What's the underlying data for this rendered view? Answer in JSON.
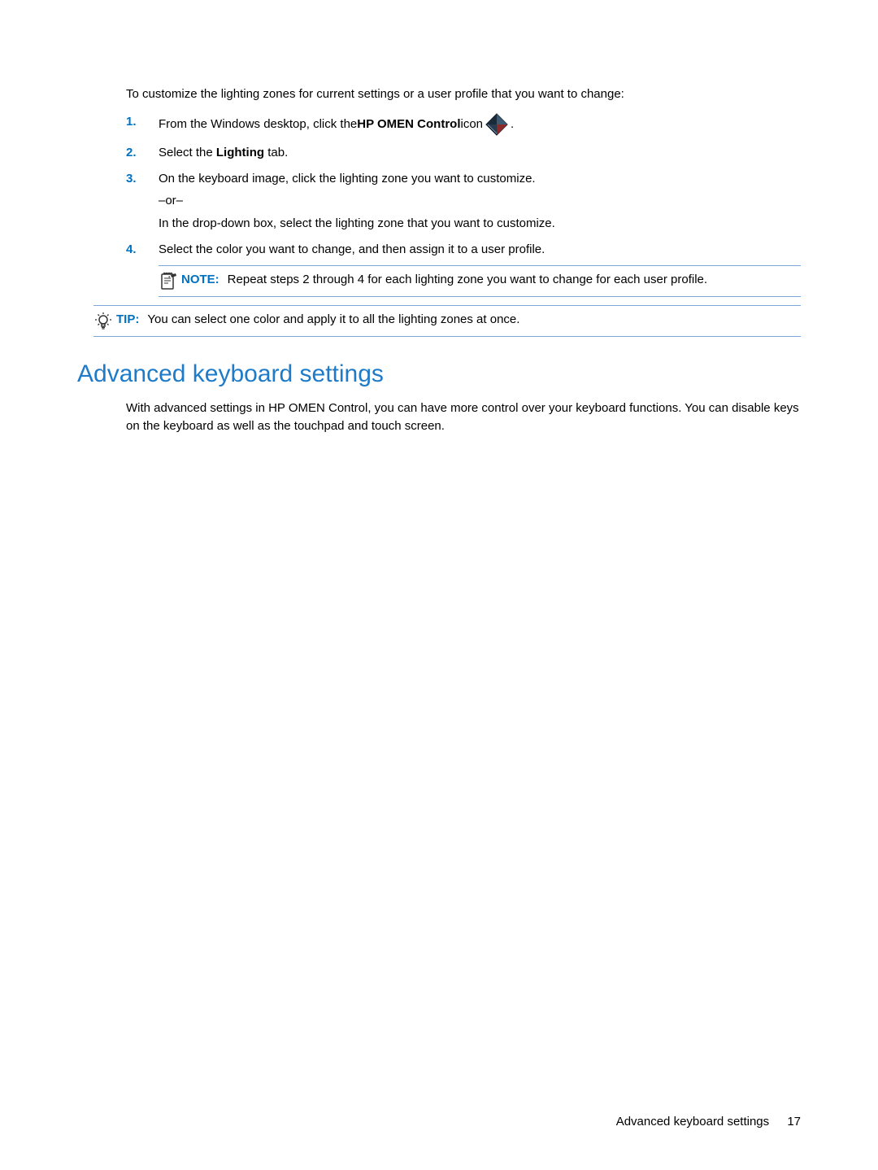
{
  "intro": "To customize the lighting zones for current settings or a user profile that you want to change:",
  "steps": {
    "s1": {
      "num": "1.",
      "pre": "From the Windows desktop, click the ",
      "bold": "HP OMEN Control",
      "mid": " icon ",
      "post": "."
    },
    "s2": {
      "num": "2.",
      "pre": "Select the ",
      "bold": "Lighting",
      "post": " tab."
    },
    "s3": {
      "num": "3.",
      "line1": "On the keyboard image, click the lighting zone you want to customize.",
      "or": "–or–",
      "line2": "In the drop-down box, select the lighting zone that you want to customize."
    },
    "s4": {
      "num": "4.",
      "text": "Select the color you want to change, and then assign it to a user profile."
    }
  },
  "note": {
    "label": "NOTE:",
    "text": "Repeat steps 2 through 4 for each lighting zone you want to change for each user profile."
  },
  "tip": {
    "label": "TIP:",
    "text": "You can select one color and apply it to all the lighting zones at once."
  },
  "heading": "Advanced keyboard settings",
  "section_body": "With advanced settings in HP OMEN Control, you can have more control over your keyboard functions. You can disable keys on the keyboard as well as the touchpad and touch screen.",
  "footer": {
    "label": "Advanced keyboard settings",
    "page": "17"
  }
}
